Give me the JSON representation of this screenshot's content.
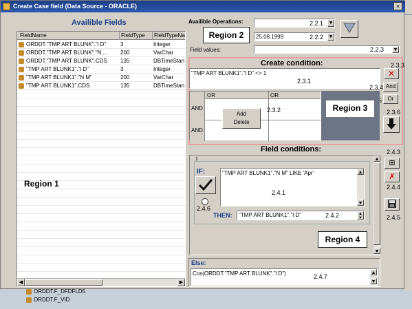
{
  "window": {
    "title": "Create Case field (Data Source - ORACLE)",
    "close": "×"
  },
  "left": {
    "heading": "Availible Fields",
    "columns": [
      "FieldName",
      "FieldType",
      "FieldTypeNa"
    ],
    "rows": [
      [
        "ORDDT.\"TMP ART BLUNK\".\"l D\"",
        "3",
        "Integer"
      ],
      [
        "ORDDT.\"TMP ART BLUNK\".\"N  ...",
        "200",
        "VarChar"
      ],
      [
        "ORDDT.\"TMP ART BLUNK\".CDS",
        "135",
        "DBTimeStan"
      ],
      [
        "\"TMP ART BLUNK1\".\"l D\"",
        "3",
        "Integer"
      ],
      [
        "\"TMP ART BLUNK1\".\"N  M\"",
        "200",
        "VarChar"
      ],
      [
        "\"TMP ART BLUNK1\".CDS",
        "135",
        "DBTimeStan"
      ]
    ],
    "region_label": "Region 1",
    "tree_items": [
      "ORDDT.F_DFDFLD5",
      "ORDDT.F_VID"
    ]
  },
  "ops": {
    "label": "Availible Operations:",
    "region": "Region 2",
    "op_tag": "2.2.1",
    "date_value": "25.08.1999",
    "date_tag": "2.2.2",
    "field_values_label": "Field values:",
    "field_values_tag": "2.2.3"
  },
  "create": {
    "heading": "Create condition:",
    "condition_text": "\"TMP ART BLUNK1\".\"l D\" <> 1",
    "condition_tag": "2.3.1",
    "del_tag": "2.3.3",
    "and_label": "And",
    "and_tag": "2.3.4",
    "or_label": "Or",
    "or_tag": "2.3.5",
    "down_tag": "2.3.6",
    "grid_or1": "OR",
    "grid_or2": "OR",
    "grid_and1": "AND",
    "grid_and2": "AND",
    "add_label": "Add",
    "delete_label": "Delete",
    "grid_tag": "2.3.2",
    "region": "Region 3"
  },
  "fieldcond": {
    "heading": "Field conditions:",
    "index": "1",
    "if_label": "IF:",
    "if_text": "\"TMP ART BLUNK1\".\"N  M\" LIKE 'Apr'",
    "if_tag": "2.4.1",
    "radio_tag": "2.4.6",
    "then_label": "THEN:",
    "then_text": "\"TMP ART BLUNK1\".\"l D\"",
    "then_tag": "2.4.2",
    "region": "Region 4",
    "add_tag": "2.4.3",
    "del_tag": "2.4.4",
    "save_tag": "2.4.5"
  },
  "else": {
    "label": "Else:",
    "text": "Cos(ORDDT.\"TMP ART BLUNK\".\"l D\")",
    "tag": "2.4.7"
  }
}
